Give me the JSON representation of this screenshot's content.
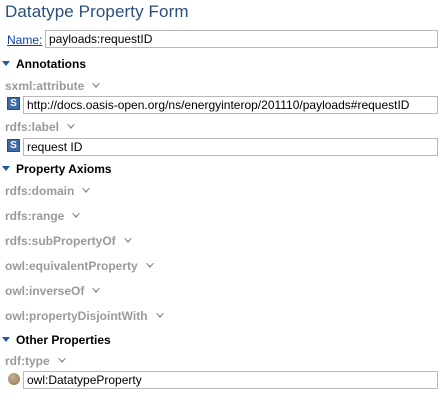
{
  "form": {
    "title": "Datatype Property Form",
    "name_label": "Name:",
    "name_value": "payloads:requestID"
  },
  "sections": {
    "annotations": {
      "label": "Annotations",
      "props": [
        {
          "name": "sxml:attribute",
          "value": "http://docs.oasis-open.org/ns/energyinterop/201110/payloads#requestID",
          "badge": "S"
        },
        {
          "name": "rdfs:label",
          "value": "request ID",
          "badge": "S"
        }
      ]
    },
    "property_axioms": {
      "label": "Property Axioms",
      "props": [
        {
          "name": "rdfs:domain"
        },
        {
          "name": "rdfs:range"
        },
        {
          "name": "rdfs:subPropertyOf"
        },
        {
          "name": "owl:equivalentProperty"
        },
        {
          "name": "owl:inverseOf"
        },
        {
          "name": "owl:propertyDisjointWith"
        }
      ]
    },
    "other_properties": {
      "label": "Other Properties",
      "props": [
        {
          "name": "rdf:type",
          "value": "owl:DatatypeProperty",
          "badge": "resource-dot"
        }
      ]
    }
  }
}
